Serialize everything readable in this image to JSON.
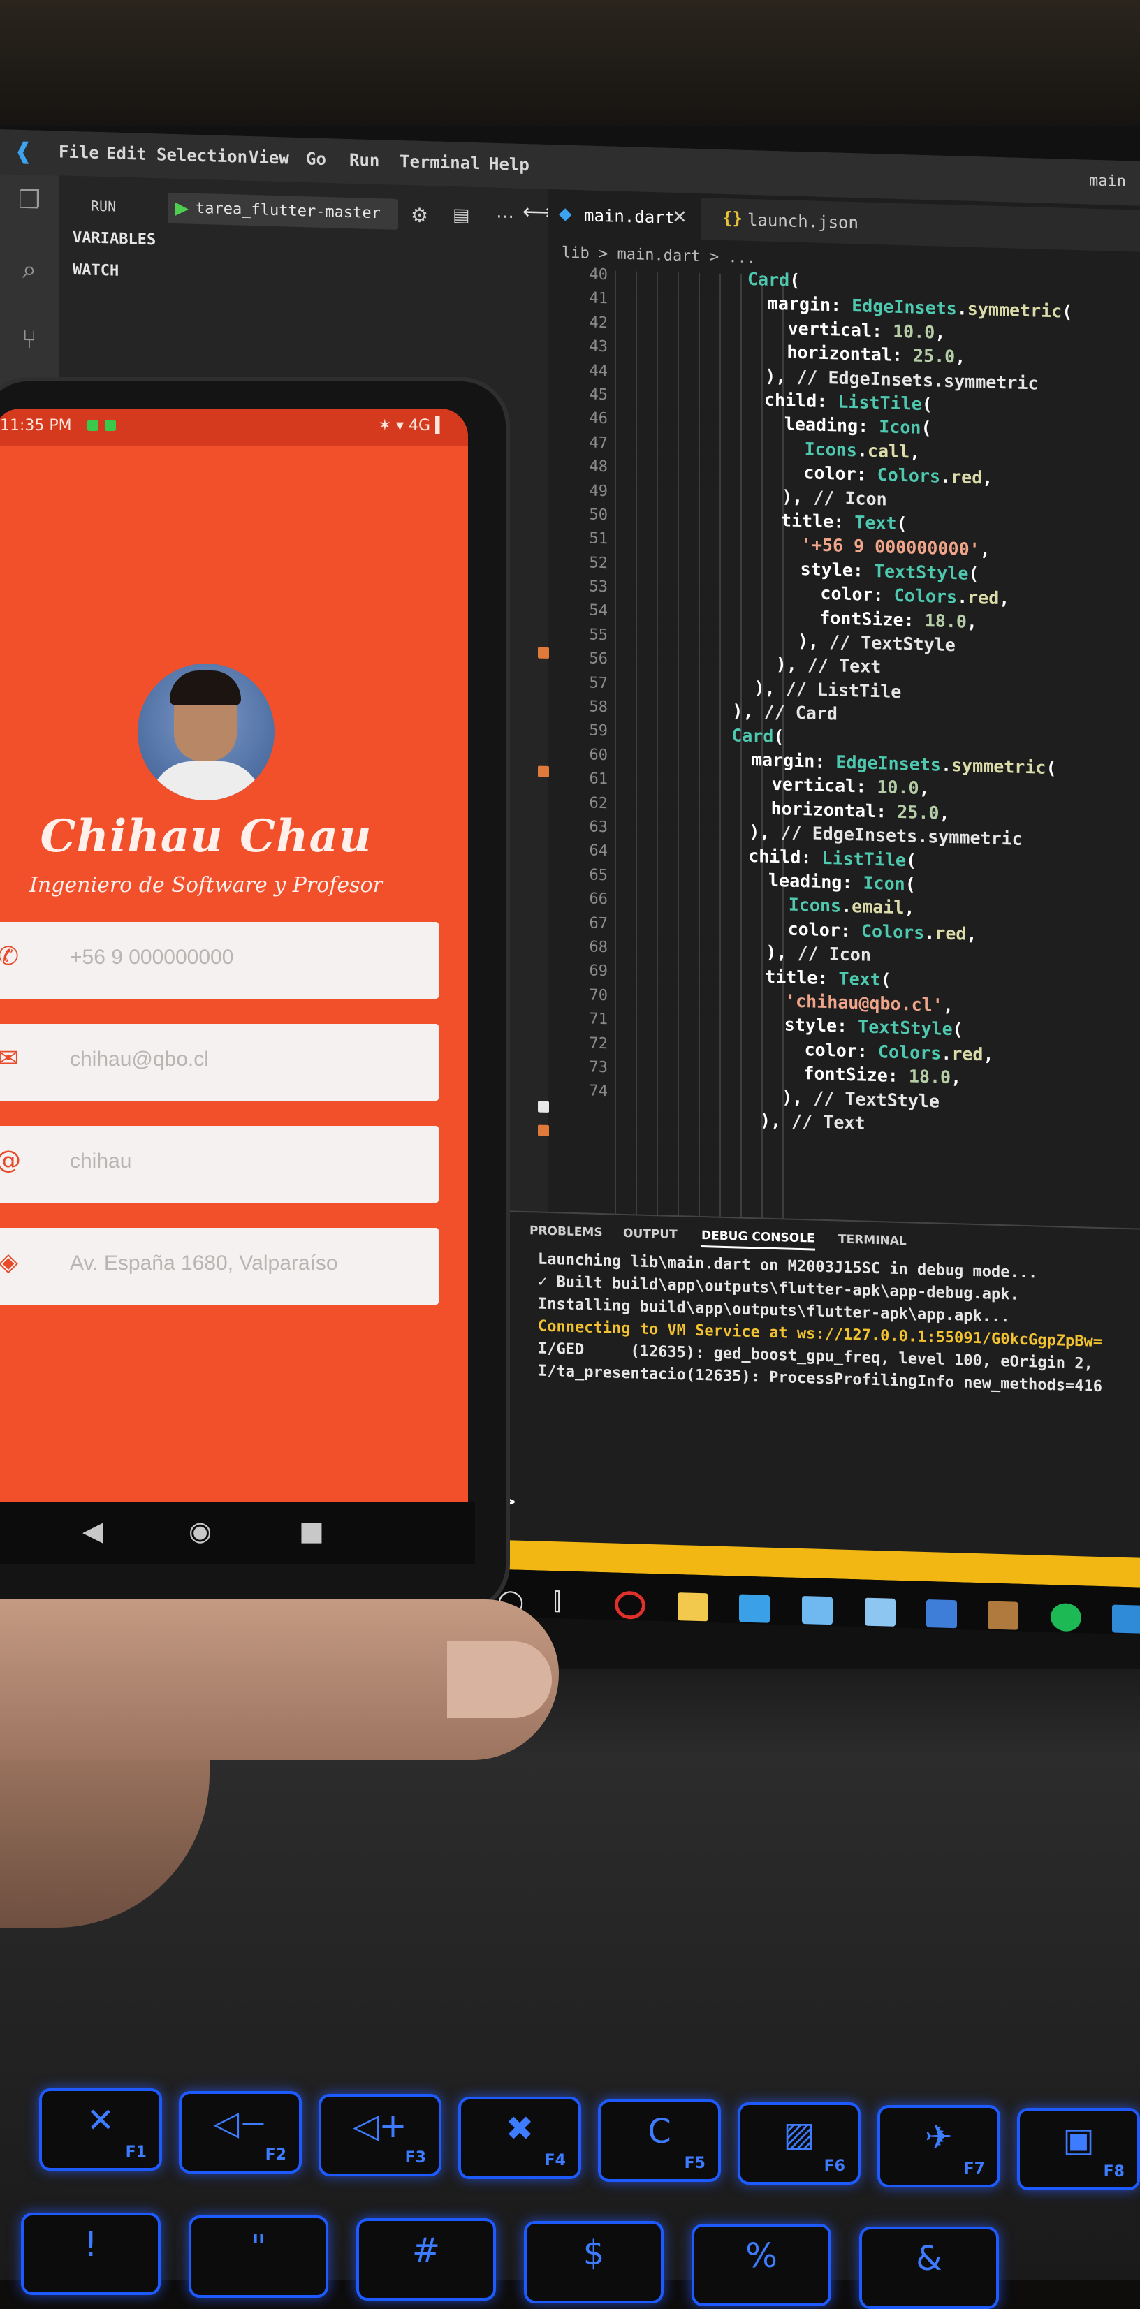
{
  "vscode": {
    "menu": [
      "File",
      "Edit",
      "Selection",
      "View",
      "Go",
      "Run",
      "Terminal",
      "Help"
    ],
    "window_title_fragment": "main",
    "sidebar": {
      "run_label": "RUN",
      "run_config": "tarea_flutter-master",
      "sections": [
        "VARIABLES",
        "WATCH"
      ]
    },
    "tabs": [
      {
        "label": "main.dart",
        "active": true
      },
      {
        "label": "launch.json",
        "active": false
      }
    ],
    "breadcrumb": "lib > main.dart > ...",
    "line_numbers": [
      "40",
      "41",
      "42",
      "43",
      "44",
      "45",
      "46",
      "47",
      "48",
      "49",
      "50",
      "51",
      "52",
      "53",
      "54",
      "55",
      "56",
      "57",
      "58",
      "59",
      "60",
      "61",
      "62",
      "63",
      "64",
      "65",
      "66",
      "67",
      "68",
      "69",
      "70",
      "71",
      "72",
      "73",
      "74"
    ],
    "code_lines": [
      "Card(",
      "  margin: EdgeInsets.symmetric(",
      "    vertical: 10.0,",
      "    horizontal: 25.0,",
      "  ), // EdgeInsets.symmetric",
      "  child: ListTile(",
      "    leading: Icon(",
      "      Icons.call,",
      "      color: Colors.red,",
      "    ), // Icon",
      "    title: Text(",
      "      '+56 9 000000000',",
      "      style: TextStyle(",
      "        color: Colors.red,",
      "        fontSize: 18.0,",
      "      ), // TextStyle",
      "    ), // Text",
      "  ), // ListTile",
      "), // Card",
      "Card(",
      "  margin: EdgeInsets.symmetric(",
      "    vertical: 10.0,",
      "    horizontal: 25.0,",
      "  ), // EdgeInsets.symmetric",
      "  child: ListTile(",
      "    leading: Icon(",
      "      Icons.email,",
      "      color: Colors.red,",
      "    ), // Icon",
      "    title: Text(",
      "      'chihau@qbo.cl',",
      "      style: TextStyle(",
      "        color: Colors.red,",
      "        fontSize: 18.0,",
      "      ), // TextStyle",
      "    ), // Text"
    ],
    "panel_tabs": [
      "PROBLEMS",
      "OUTPUT",
      "DEBUG CONSOLE",
      "TERMINAL"
    ],
    "console_lines": [
      {
        "text": "Launching lib\\main.dart on M2003J15SC in debug mode...",
        "color": "#e6e6e6"
      },
      {
        "text": "✓ Built build\\app\\outputs\\flutter-apk\\app-debug.apk.",
        "color": "#e6e6e6"
      },
      {
        "text": "Installing build\\app\\outputs\\flutter-apk\\app.apk...",
        "color": "#e6e6e6"
      },
      {
        "text": "Connecting to VM Service at ws://127.0.0.1:55091/G0kcGgpZpBw=",
        "color": "#f2c230"
      },
      {
        "text": "I/GED     (12635): ged_boost_gpu_freq, level 100, eOrigin 2, ",
        "color": "#e6e6e6"
      },
      {
        "text": "I/ta_presentacio(12635): ProcessProfilingInfo new_methods=416",
        "color": "#e6e6e6"
      }
    ],
    "prompt": ">",
    "statusbar_color": "#f2b713"
  },
  "phone": {
    "status_time": "11:35 PM",
    "status_icons": "✶ ▾ 4G ▍",
    "accent": "#f1502b",
    "name": "Chihau Chau",
    "subtitle": "Ingeniero de Software y Profesor",
    "cards": [
      {
        "icon": "phone-icon",
        "glyph": "✆",
        "text": "+56 9 000000000"
      },
      {
        "icon": "mail-icon",
        "glyph": "✉",
        "text": "chihau@qbo.cl"
      },
      {
        "icon": "at-icon",
        "glyph": "@",
        "text": "chihau"
      },
      {
        "icon": "location-icon",
        "glyph": "◈",
        "text": "Av. España 1680, Valparaíso"
      }
    ]
  },
  "keyboard": {
    "fn_keys": [
      {
        "icon": "mute-icon",
        "glyph": "✕",
        "label": "F1"
      },
      {
        "icon": "volume-down-icon",
        "glyph": "◁−",
        "label": "F2"
      },
      {
        "icon": "volume-up-icon",
        "glyph": "◁+",
        "label": "F3"
      },
      {
        "icon": "mic-off-icon",
        "glyph": "✖",
        "label": "F4"
      },
      {
        "icon": "refresh-icon",
        "glyph": "C",
        "label": "F5"
      },
      {
        "icon": "display-off-icon",
        "glyph": "▨",
        "label": "F6"
      },
      {
        "icon": "airplane-icon",
        "glyph": "✈",
        "label": "F7"
      },
      {
        "icon": "camera-off-icon",
        "glyph": "▣",
        "label": "F8"
      }
    ],
    "number_row": [
      "!",
      "\"",
      "#",
      "$",
      "%",
      "&"
    ]
  }
}
